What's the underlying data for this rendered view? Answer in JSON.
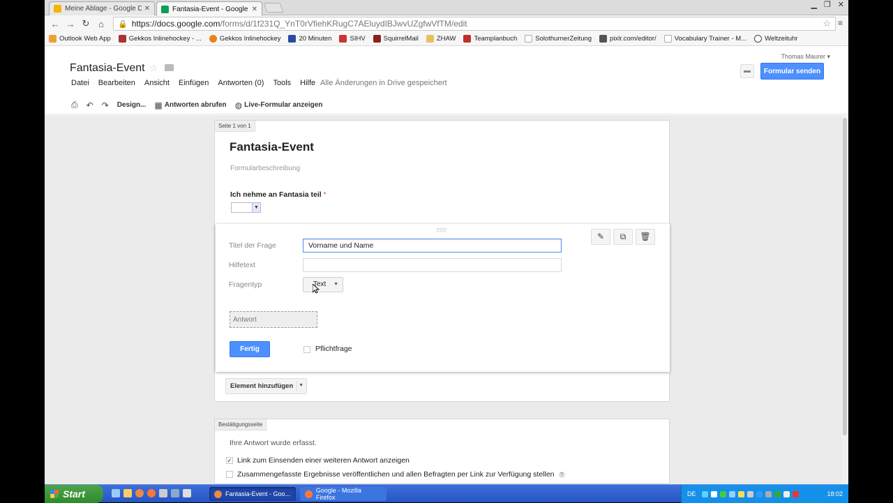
{
  "browser": {
    "tabs": [
      {
        "title": "Meine Ablage - Google Drive",
        "active": false,
        "icon": "drive-icon"
      },
      {
        "title": "Fantasia-Event - Google Drive",
        "active": true,
        "icon": "forms-icon"
      }
    ],
    "url_host": "https://docs.google.com",
    "url_path": "/forms/d/1f231Q_YnT0rVfiehKRugC7AEluydIBJwvUZgfwVfTM/edit",
    "bookmarks": [
      "Outlook Web App",
      "Gekkos Inlinehockey - ...",
      "Gekkos Inlinehockey",
      "20 Minuten",
      "SIHV",
      "SquirrelMail",
      "ZHAW",
      "Teamplanbuch",
      "SolothurnerZeitung",
      "pixlr.com/editor/",
      "Vocabulary Trainer - M...",
      "Weltzeituhr"
    ]
  },
  "docs": {
    "title": "Fantasia-Event",
    "menus": [
      "Datei",
      "Bearbeiten",
      "Ansicht",
      "Einfügen",
      "Antworten (0)",
      "Tools",
      "Hilfe"
    ],
    "saved_status": "Alle Änderungen in Drive gespeichert",
    "user": "Thomas Maurer",
    "send_button": "Formular senden",
    "toolbar": {
      "design": "Design...",
      "responses": "Antworten abrufen",
      "live": "Live-Formular anzeigen"
    }
  },
  "form": {
    "page_tag": "Seite 1 von 1",
    "title": "Fantasia-Event",
    "description_placeholder": "Formularbeschreibung",
    "question1": {
      "label": "Ich nehme an Fantasia teil",
      "required_mark": "*"
    },
    "editor": {
      "title_label": "Titel der Frage",
      "title_value": "Vorname und Name",
      "help_label": "Hilfetext",
      "help_value": "",
      "type_label": "Fragentyp",
      "type_value": "Text",
      "answer_preview": "Antwort",
      "done_button": "Fertig",
      "required_label": "Pflichtfrage",
      "required_checked": false
    },
    "add_element": "Element hinzufügen"
  },
  "confirmation": {
    "tag": "Bestätigungsseite",
    "message": "Ihre Antwort wurde erfasst.",
    "opt1": {
      "label": "Link zum Einsenden einer weiteren Antwort anzeigen",
      "checked": true
    },
    "opt2": {
      "label": "Zusammengefasste Ergebnisse veröffentlichen und allen Befragten per Link zur Verfügung stellen",
      "checked": false
    }
  },
  "taskbar": {
    "start": "Start",
    "tasks": [
      {
        "title": "Fantasia-Event - Goo...",
        "active": true
      },
      {
        "title": "Google - Mozilla Firefox",
        "active": false
      }
    ],
    "lang": "DE",
    "clock": "18:02"
  },
  "colors": {
    "accent": "#4d90fe",
    "required": "#d14836"
  }
}
